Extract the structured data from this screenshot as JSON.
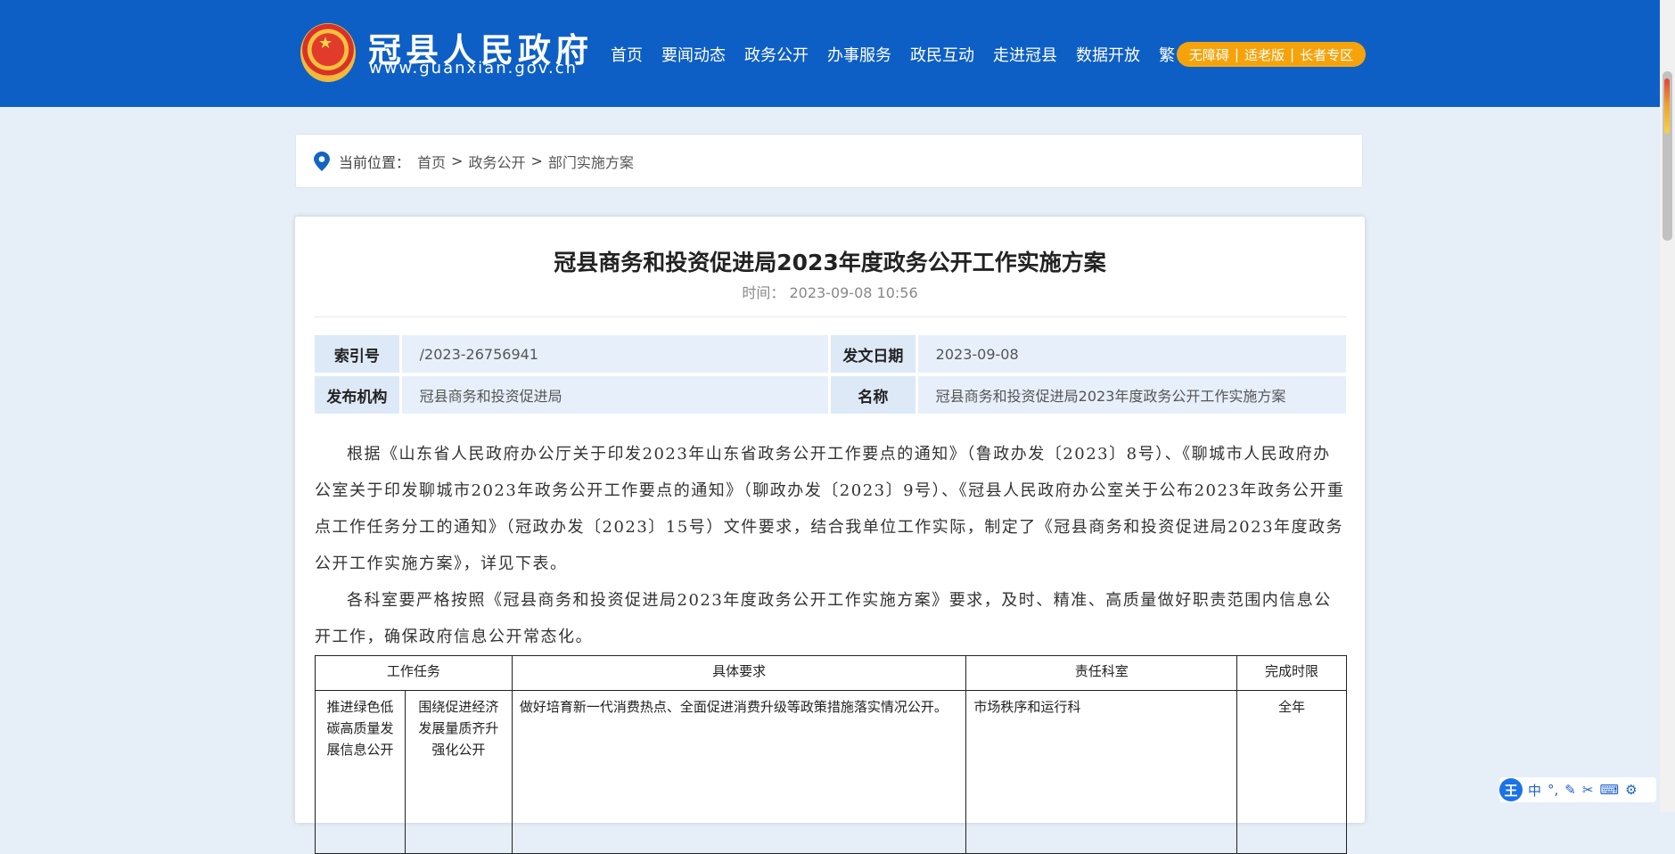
{
  "header": {
    "site_title": "冠县人民政府",
    "site_url": "www.guanxian.gov.cn",
    "nav": [
      "首页",
      "要闻动态",
      "政务公开",
      "办事服务",
      "政民互动",
      "走进冠县",
      "数据开放",
      "繁"
    ],
    "accessibility": [
      "无障碍",
      "适老版",
      "长者专区"
    ],
    "accessibility_sep": "|"
  },
  "breadcrumb": {
    "label": "当前位置：",
    "items": [
      "首页",
      "政务公开",
      "部门实施方案"
    ],
    "separator": ">"
  },
  "article": {
    "title": "冠县商务和投资促进局2023年度政务公开工作实施方案",
    "time_label": "时间：",
    "time_value": "2023-09-08 10:56",
    "meta": {
      "index_label": "索引号",
      "index_value": "/2023-26756941",
      "date_label": "发文日期",
      "date_value": "2023-09-08",
      "org_label": "发布机构",
      "org_value": "冠县商务和投资促进局",
      "name_label": "名称",
      "name_value": "冠县商务和投资促进局2023年度政务公开工作实施方案"
    },
    "paragraphs": [
      "根据《山东省人民政府办公厅关于印发2023年山东省政务公开工作要点的通知》（鲁政办发〔2023〕8号）、《聊城市人民政府办公室关于印发聊城市2023年政务公开工作要点的通知》（聊政办发〔2023〕9号）、《冠县人民政府办公室关于公布2023年政务公开重点工作任务分工的通知》（冠政办发〔2023〕15号）文件要求，结合我单位工作实际，制定了《冠县商务和投资促进局2023年度政务公开工作实施方案》，详见下表。",
      "各科室要严格按照《冠县商务和投资促进局2023年度政务公开工作实施方案》要求，及时、精准、高质量做好职责范围内信息公开工作，确保政府信息公开常态化。"
    ],
    "table": {
      "headers": [
        "工作任务",
        "具体要求",
        "责任科室",
        "完成时限"
      ],
      "rows": [
        {
          "task_main": "推进绿色低碳高质量发展信息公开",
          "task_sub": "围绕促进经济发展量质齐升强化公开",
          "requirement": "做好培育新一代消费热点、全面促进消费升级等政策措施落实情况公开。",
          "department": "市场秩序和运行科",
          "deadline": "全年"
        }
      ]
    }
  },
  "ime": {
    "logo": "王",
    "items": [
      "中",
      "°,",
      "✎",
      "✂",
      "⌨",
      "⚙"
    ]
  },
  "colors": {
    "header_bg": "#0d5fc5",
    "accent_orange": "#f6a30b",
    "page_bg": "#e6eef8",
    "meta_label_bg": "#dde9f7"
  }
}
